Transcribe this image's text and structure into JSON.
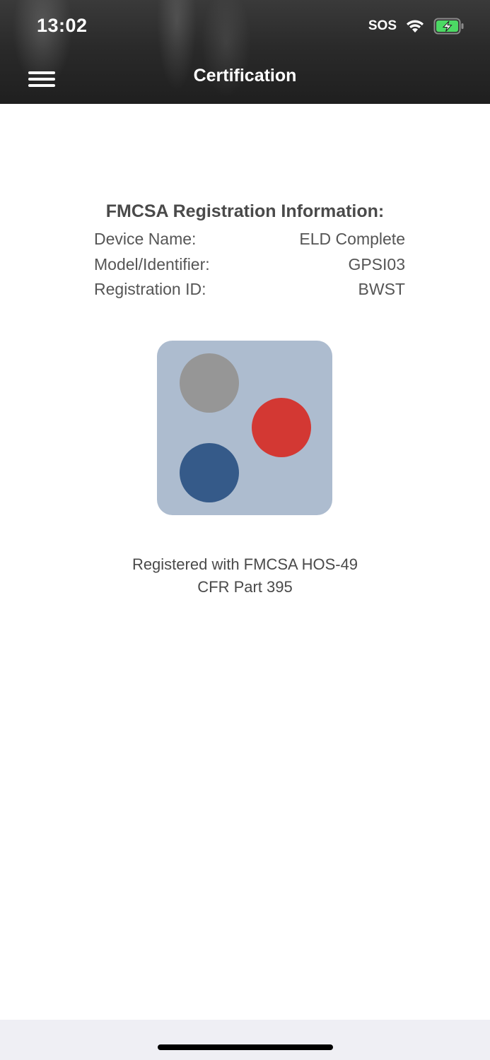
{
  "status_bar": {
    "time": "13:02",
    "sos": "SOS",
    "icons": [
      "wifi-icon",
      "battery-charging-icon"
    ]
  },
  "header": {
    "title": "Certification",
    "menu_icon": "hamburger-menu-icon"
  },
  "registration": {
    "title": "FMCSA Registration Information:",
    "rows": [
      {
        "label": "Device Name:",
        "value": "ELD Complete"
      },
      {
        "label": "Model/Identifier:",
        "value": "GPSI03"
      },
      {
        "label": "Registration ID:",
        "value": "BWST"
      }
    ]
  },
  "logo": {
    "icon": "eld-logo-icon",
    "colors": {
      "background": "#adbccf",
      "gray": "#969696",
      "red": "#d33833",
      "blue": "#355a89"
    }
  },
  "footer_text": {
    "line1": "Registered with FMCSA HOS-49",
    "line2": "CFR Part 395"
  },
  "colors": {
    "header_bg": "#2a2a2a",
    "text": "#4a4a4a",
    "battery_green": "#4cd964"
  }
}
